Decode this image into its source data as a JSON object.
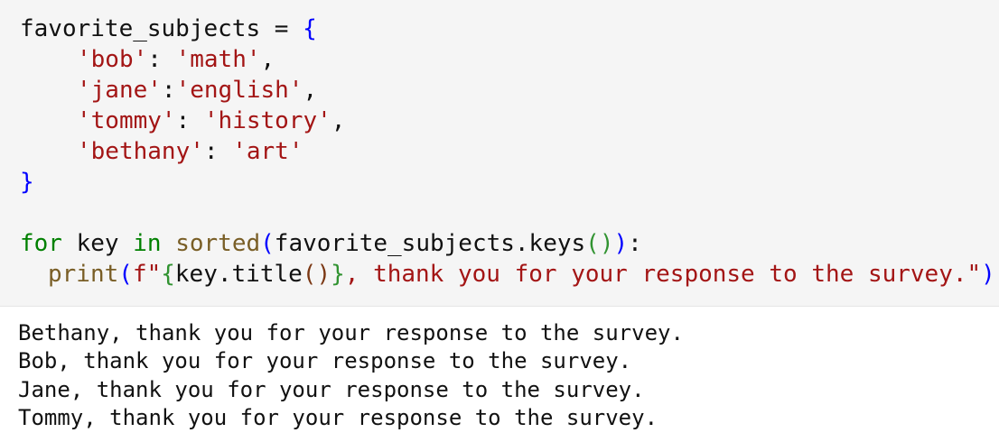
{
  "code": {
    "dict_name": "favorite_subjects",
    "assign": " = ",
    "open_brace": "{",
    "close_brace": "}",
    "entries": [
      {
        "key": "'bob'",
        "sep": ": ",
        "value": "'math'",
        "trail": ","
      },
      {
        "key": "'jane'",
        "sep": ":",
        "value": "'english'",
        "trail": ","
      },
      {
        "key": "'tommy'",
        "sep": ": ",
        "value": "'history'",
        "trail": ","
      },
      {
        "key": "'bethany'",
        "sep": ": ",
        "value": "'art'",
        "trail": ""
      }
    ],
    "loop": {
      "for_kw": "for",
      "var": " key ",
      "in_kw": "in",
      "space": " ",
      "sorted_fn": "sorted",
      "paren_open": "(",
      "target": "favorite_subjects.keys",
      "call_parens_open": "(",
      "call_parens_close": ")",
      "paren_close": ")",
      "colon": ":"
    },
    "print_stmt": {
      "fn": "print",
      "paren_open": "(",
      "fstring_prefix": "f\"",
      "brace_open": "{",
      "expr": "key.title",
      "call_open": "(",
      "call_close": ")",
      "brace_close": "}",
      "rest": ", thank you for your response to the survey.\"",
      "paren_close": ")"
    }
  },
  "output": {
    "lines": [
      "Bethany, thank you for your response to the survey.",
      "Bob, thank you for your response to the survey.",
      "Jane, thank you for your response to the survey.",
      "Tommy, thank you for your response to the survey."
    ]
  },
  "colors": {
    "code_background": "#f5f5f5",
    "keyword": "#008000",
    "builtin": "#795e26",
    "string": "#a31515",
    "bracket_level1": "#0000ff",
    "bracket_level2": "#319331",
    "bracket_level3": "#7b3814",
    "text": "#111111"
  }
}
